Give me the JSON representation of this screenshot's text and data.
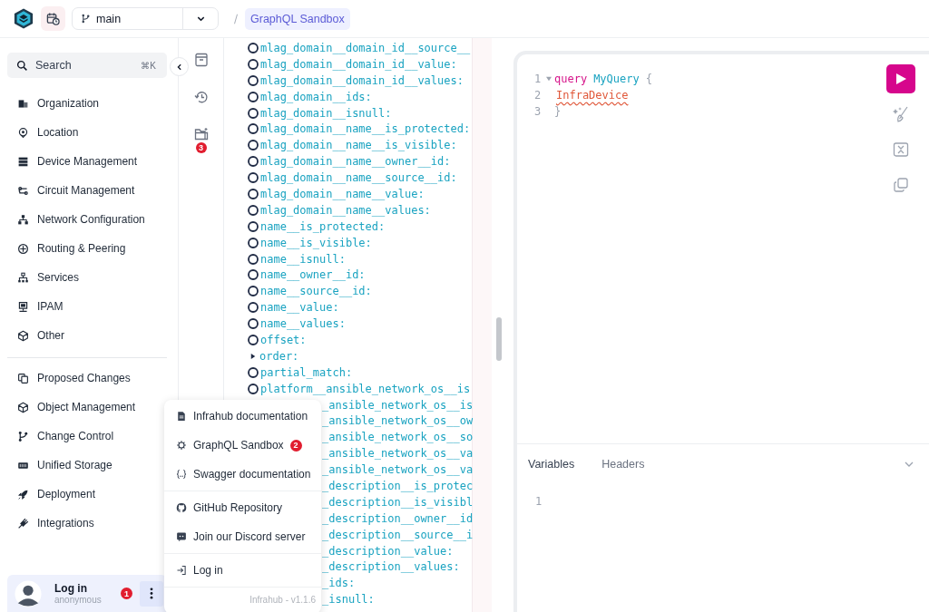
{
  "topbar": {
    "branch": "main",
    "breadcrumb": "GraphQL Sandbox"
  },
  "sidebar": {
    "search": {
      "placeholder": "Search",
      "shortcut": "⌘K"
    },
    "groups": [
      [
        {
          "kind": "building",
          "label": "Organization"
        },
        {
          "kind": "pin",
          "label": "Location"
        },
        {
          "kind": "server",
          "label": "Device Management"
        },
        {
          "kind": "circuit",
          "label": "Circuit Management"
        },
        {
          "kind": "network",
          "label": "Network Configuration"
        },
        {
          "kind": "routing",
          "label": "Routing & Peering"
        },
        {
          "kind": "services",
          "label": "Services"
        },
        {
          "kind": "ipam",
          "label": "IPAM"
        },
        {
          "kind": "cube",
          "label": "Other"
        }
      ],
      [
        {
          "kind": "changes",
          "label": "Proposed Changes"
        },
        {
          "kind": "cube",
          "label": "Object Management"
        },
        {
          "kind": "branch",
          "label": "Change Control"
        },
        {
          "kind": "storage",
          "label": "Unified Storage"
        },
        {
          "kind": "rocket",
          "label": "Deployment"
        },
        {
          "kind": "plug",
          "label": "Integrations"
        }
      ]
    ],
    "user": {
      "name": "Log in",
      "subtitle": "anonymous",
      "badge": "1"
    }
  },
  "rail": {
    "badge": "3"
  },
  "explorer": {
    "rows": [
      {
        "kind": "field",
        "text": "mlag_domain__domain_id__source__",
        "checked": false
      },
      {
        "kind": "field",
        "text": "mlag_domain__domain_id__value:",
        "checked": false
      },
      {
        "kind": "field",
        "text": "mlag_domain__domain_id__values:",
        "checked": false
      },
      {
        "kind": "field",
        "text": "mlag_domain__ids:",
        "checked": false
      },
      {
        "kind": "field",
        "text": "mlag_domain__isnull:",
        "checked": false
      },
      {
        "kind": "field",
        "text": "mlag_domain__name__is_protected:",
        "checked": false
      },
      {
        "kind": "field",
        "text": "mlag_domain__name__is_visible:",
        "checked": false
      },
      {
        "kind": "field",
        "text": "mlag_domain__name__owner__id:",
        "checked": false
      },
      {
        "kind": "field",
        "text": "mlag_domain__name__source__id:",
        "checked": false
      },
      {
        "kind": "field",
        "text": "mlag_domain__name__value:",
        "checked": false
      },
      {
        "kind": "field",
        "text": "mlag_domain__name__values:",
        "checked": false
      },
      {
        "kind": "field",
        "text": "name__is_protected:",
        "checked": false
      },
      {
        "kind": "field",
        "text": "name__is_visible:",
        "checked": false
      },
      {
        "kind": "field",
        "text": "name__isnull:",
        "checked": false
      },
      {
        "kind": "field",
        "text": "name__owner__id:",
        "checked": false
      },
      {
        "kind": "field",
        "text": "name__source__id:",
        "checked": false
      },
      {
        "kind": "field",
        "text": "name__value:",
        "checked": false
      },
      {
        "kind": "field",
        "text": "name__values:",
        "checked": false
      },
      {
        "kind": "field",
        "text": "offset:",
        "checked": false
      },
      {
        "kind": "object",
        "text": "order:",
        "expanded": false
      },
      {
        "kind": "field",
        "text": "partial_match:",
        "checked": false
      },
      {
        "kind": "field",
        "text": "platform__ansible_network_os__is",
        "checked": false
      },
      {
        "kind": "covered",
        "text": "_ansible_network_os__is"
      },
      {
        "kind": "covered",
        "text": "_ansible_network_os__ow"
      },
      {
        "kind": "covered",
        "text": "_ansible_network_os__so"
      },
      {
        "kind": "covered",
        "text": "_ansible_network_os__va"
      },
      {
        "kind": "covered",
        "text": "_ansible_network_os__va"
      },
      {
        "kind": "covered",
        "text": "_description__is_protec"
      },
      {
        "kind": "covered",
        "text": "_description__is_visibl"
      },
      {
        "kind": "covered",
        "text": "_description__owner__id"
      },
      {
        "kind": "covered",
        "text": "_description__source__i"
      },
      {
        "kind": "covered",
        "text": "_description__value:"
      },
      {
        "kind": "covered",
        "text": "_description__values:"
      },
      {
        "kind": "covered",
        "text": "_ids:"
      },
      {
        "kind": "covered",
        "text": "_isnull:"
      }
    ]
  },
  "editor": {
    "lines": [
      {
        "number": "1",
        "foldable": true,
        "tokens": [
          {
            "kind": "keyword",
            "text": "query"
          },
          {
            "kind": "name",
            "text": "MyQuery"
          },
          {
            "kind": "punct",
            "text": "{"
          }
        ]
      },
      {
        "number": "2",
        "foldable": false,
        "tokens": [
          {
            "kind": "error",
            "text": "InfraDevice"
          }
        ]
      },
      {
        "number": "3",
        "foldable": false,
        "tokens": [
          {
            "kind": "punct",
            "text": "}"
          }
        ]
      }
    ]
  },
  "variables": {
    "tabs": [
      {
        "label": "Variables",
        "selected": true
      },
      {
        "label": "Headers",
        "selected": false
      }
    ],
    "lines": [
      "1"
    ]
  },
  "menu": {
    "groups": [
      [
        {
          "kind": "document",
          "label": "Infrahub documentation"
        },
        {
          "kind": "gear",
          "label": "GraphQL Sandbox",
          "badge": "2"
        },
        {
          "kind": "braces",
          "label": "Swagger documentation"
        }
      ],
      [
        {
          "kind": "github",
          "label": "GitHub Repository"
        },
        {
          "kind": "discord",
          "label": "Join our Discord server"
        }
      ],
      [
        {
          "kind": "login",
          "label": "Log in"
        }
      ]
    ],
    "footer": "Infrahub - v1.1.6"
  }
}
